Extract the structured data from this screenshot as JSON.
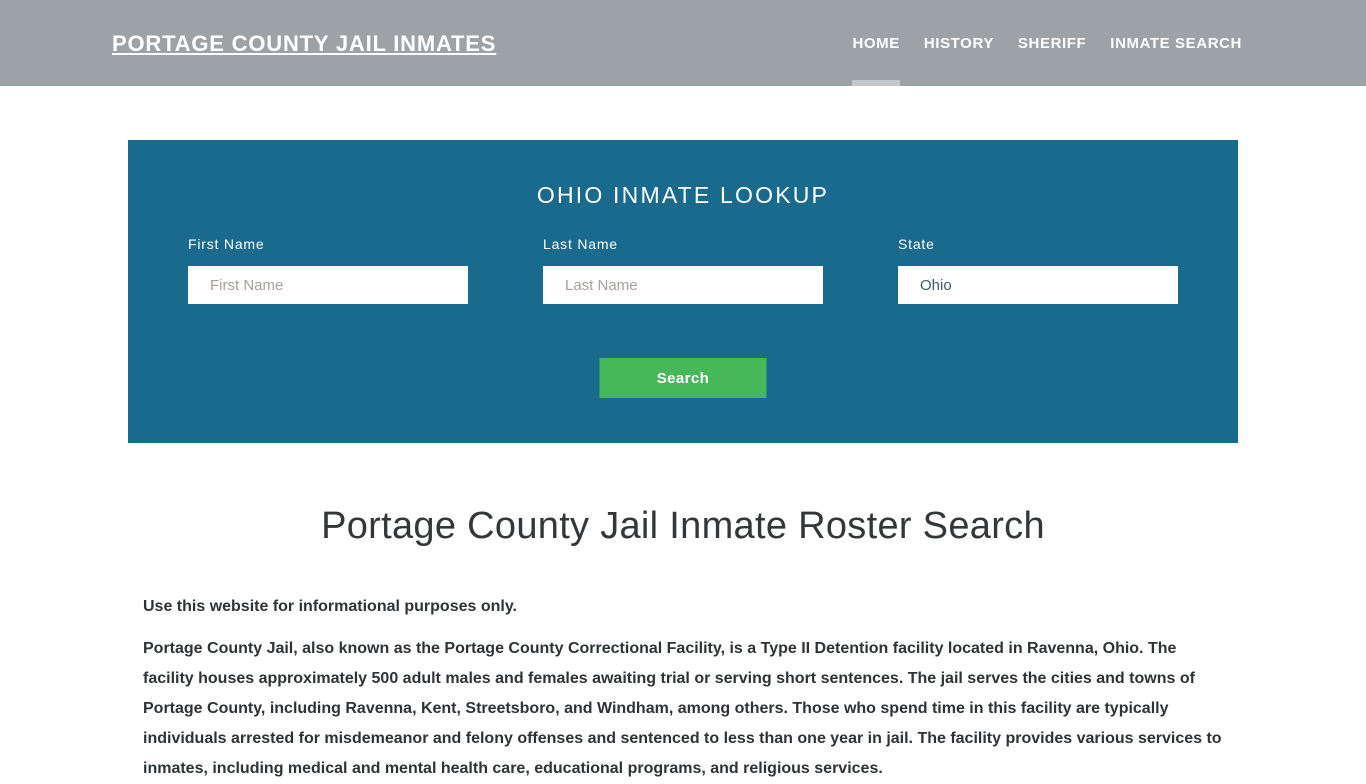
{
  "header": {
    "brand": "PORTAGE COUNTY JAIL INMATES",
    "nav": [
      {
        "label": "HOME",
        "active": true
      },
      {
        "label": "HISTORY",
        "active": false
      },
      {
        "label": "SHERIFF",
        "active": false
      },
      {
        "label": "INMATE SEARCH",
        "active": false
      }
    ]
  },
  "lookup": {
    "title": "OHIO INMATE LOOKUP",
    "first_name": {
      "label": "First Name",
      "placeholder": "First Name",
      "value": ""
    },
    "last_name": {
      "label": "Last Name",
      "placeholder": "Last Name",
      "value": ""
    },
    "state": {
      "label": "State",
      "selected": "Ohio"
    },
    "search_button": "Search"
  },
  "main": {
    "page_title": "Portage County Jail Inmate Roster Search",
    "paragraphs": [
      "Use this website for informational purposes only.",
      "Portage County Jail, also known as the Portage County Correctional Facility, is a Type II Detention facility located in Ravenna, Ohio. The facility houses approximately 500 adult males and females awaiting trial or serving short sentences. The jail serves the cities and towns of Portage County, including Ravenna, Kent, Streetsboro, and Windham, among others. Those who spend time in this facility are typically individuals arrested for misdemeanor and felony offenses and sentenced to less than one year in jail. The facility provides various services to inmates, including medical and mental health care, educational programs, and religious services."
    ]
  },
  "colors": {
    "header_gray": "#9da2a6",
    "panel_blue": "#1a6a8e",
    "button_green": "#47b859",
    "text_dark": "#2f3337",
    "active_underline": "#c3c7ca"
  }
}
